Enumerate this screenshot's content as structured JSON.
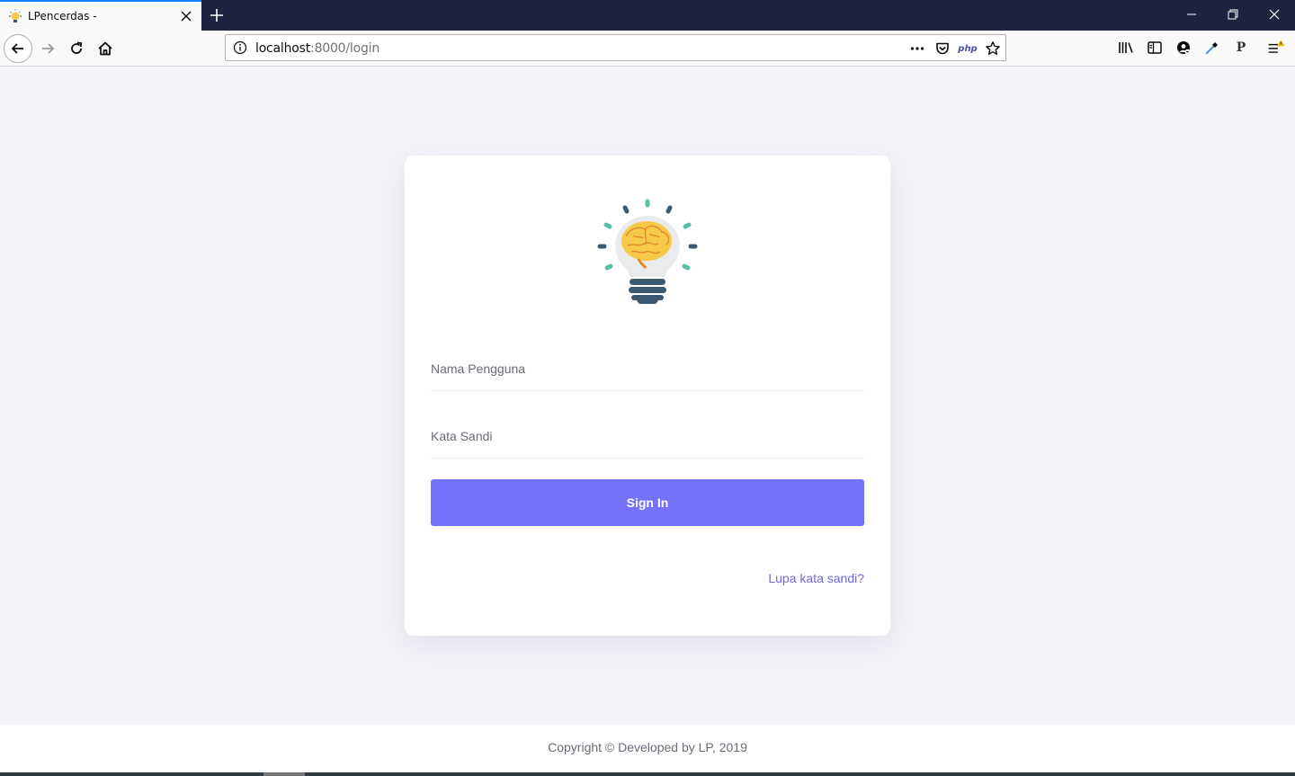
{
  "browser": {
    "tab": {
      "title": "LPencerdas -"
    },
    "url": {
      "host": "localhost",
      "rest": ":8000/login"
    },
    "php_badge": "php",
    "p_button": "P"
  },
  "login": {
    "username_placeholder": "Nama Pengguna",
    "password_placeholder": "Kata Sandi",
    "signin_label": "Sign In",
    "forgot_label": "Lupa kata sandi?"
  },
  "footer": {
    "text": "Copyright © Developed by LP, 2019"
  },
  "colors": {
    "accent": "#7472f8",
    "link": "#6d6adf",
    "page_bg": "#f3f3f8",
    "tabstrip": "#202340"
  }
}
